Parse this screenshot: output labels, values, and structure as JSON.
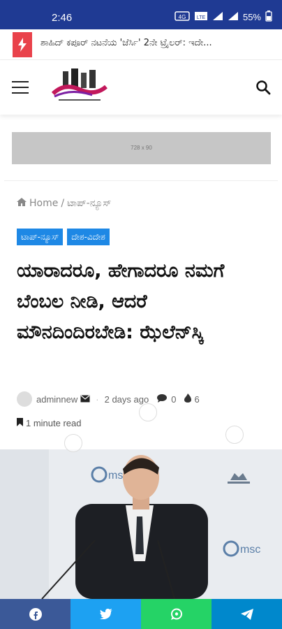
{
  "status_bar": {
    "time": "2:46",
    "battery": "55%"
  },
  "ticker": {
    "headline": "ಶಾಹಿದ್ ಕಪೂರ್ ನಟನೆಯ 'ಜೆರ್ಸಿ' 2ನೇ ಟ್ರೈಲರ್: ಇದೇ..."
  },
  "header": {
    "logo_alt": "site-logo"
  },
  "ad": {
    "label": "728 x 90"
  },
  "breadcrumb": {
    "home": "Home",
    "separator": "/",
    "current": "ಟಾಪ್-ನ್ಯೂಸ್"
  },
  "tags": [
    "ಟಾಪ್-ನ್ಯೂಸ್",
    "ದೇಶ-ವಿದೇಶ"
  ],
  "article": {
    "title": "ಯಾರಾದರೂ, ಹೇಗಾದರೂ ನಮಗೆ ಬೆಂಬಲ ನೀಡಿ, ಆದರೆ ಮೌನದಿಂದಿರಬೇಡಿ: ಝೆಲೆನ್‌ಸ್ಕಿ",
    "author": "adminnew",
    "date": "2 days ago",
    "comments": "0",
    "views": "6",
    "read_time": "1 minute read"
  },
  "hero": {
    "logo_text": "msc"
  },
  "colors": {
    "accent": "#1e88e5",
    "statusbar": "#1f3a93",
    "flash": "#e9424b",
    "facebook": "#3b5998",
    "twitter": "#1da1f2",
    "whatsapp": "#25d366",
    "telegram": "#0088cc"
  }
}
